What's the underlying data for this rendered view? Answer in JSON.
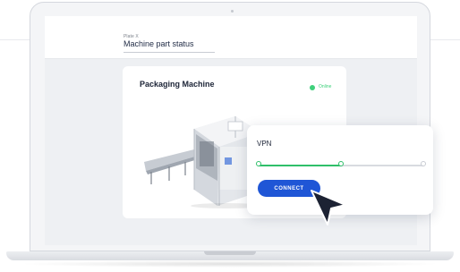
{
  "header": {
    "subtitle": "Plate X",
    "title": "Machine part status"
  },
  "machine_card": {
    "title": "Packaging Machine",
    "status": "Online",
    "status_color": "#3fd07b"
  },
  "vpn": {
    "label": "VPN",
    "progress_steps_total": 3,
    "progress_steps_completed": 1,
    "connect_label": "CONNECT",
    "accent_color": "#1f56d6",
    "progress_color": "#2fbf6a"
  },
  "icons": [
    "machine-image",
    "cursor-arrow-icon",
    "camera-icon"
  ]
}
